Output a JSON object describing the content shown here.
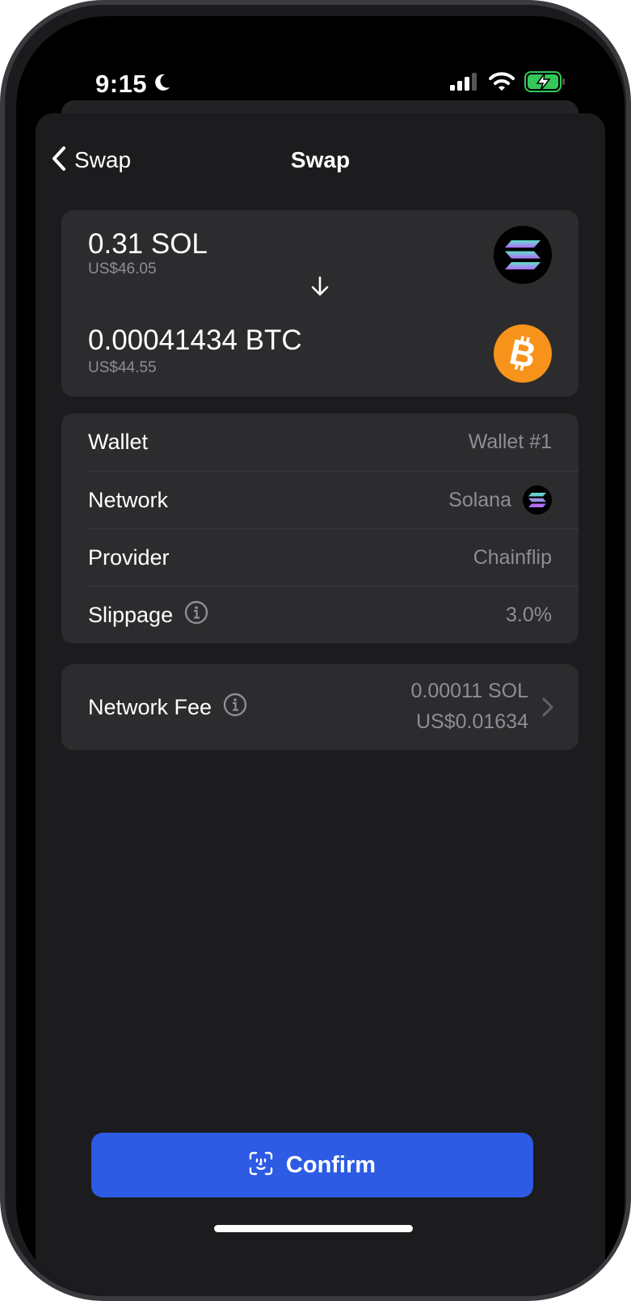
{
  "status_bar": {
    "time": "9:15",
    "icons": [
      "moon-icon",
      "cellular-signal-icon",
      "wifi-icon",
      "battery-charging-icon"
    ]
  },
  "nav": {
    "back_label": "Swap",
    "title": "Swap"
  },
  "swap": {
    "from": {
      "amount": "0.31 SOL",
      "fiat": "US$46.05",
      "icon": "solana-logo-icon"
    },
    "to": {
      "amount": "0.00041434 BTC",
      "fiat": "US$44.55",
      "icon": "bitcoin-logo-icon"
    }
  },
  "details": [
    {
      "label": "Wallet",
      "value": "Wallet #1"
    },
    {
      "label": "Network",
      "value": "Solana",
      "icon": "solana-logo-icon"
    },
    {
      "label": "Provider",
      "value": "Chainflip"
    },
    {
      "label": "Slippage",
      "value": "3.0%",
      "info": true
    }
  ],
  "network_fee": {
    "label": "Network Fee",
    "crypto": "0.00011 SOL",
    "fiat": "US$0.01634"
  },
  "confirm": {
    "label": "Confirm",
    "icon": "face-id-icon"
  },
  "colors": {
    "background": "#000000",
    "sheet": "#1c1c1e",
    "card": "#2c2c2e",
    "accent": "#2d5be3",
    "bitcoin": "#f7931a",
    "battery": "#34c759",
    "secondary_text": "#8e8e93"
  }
}
